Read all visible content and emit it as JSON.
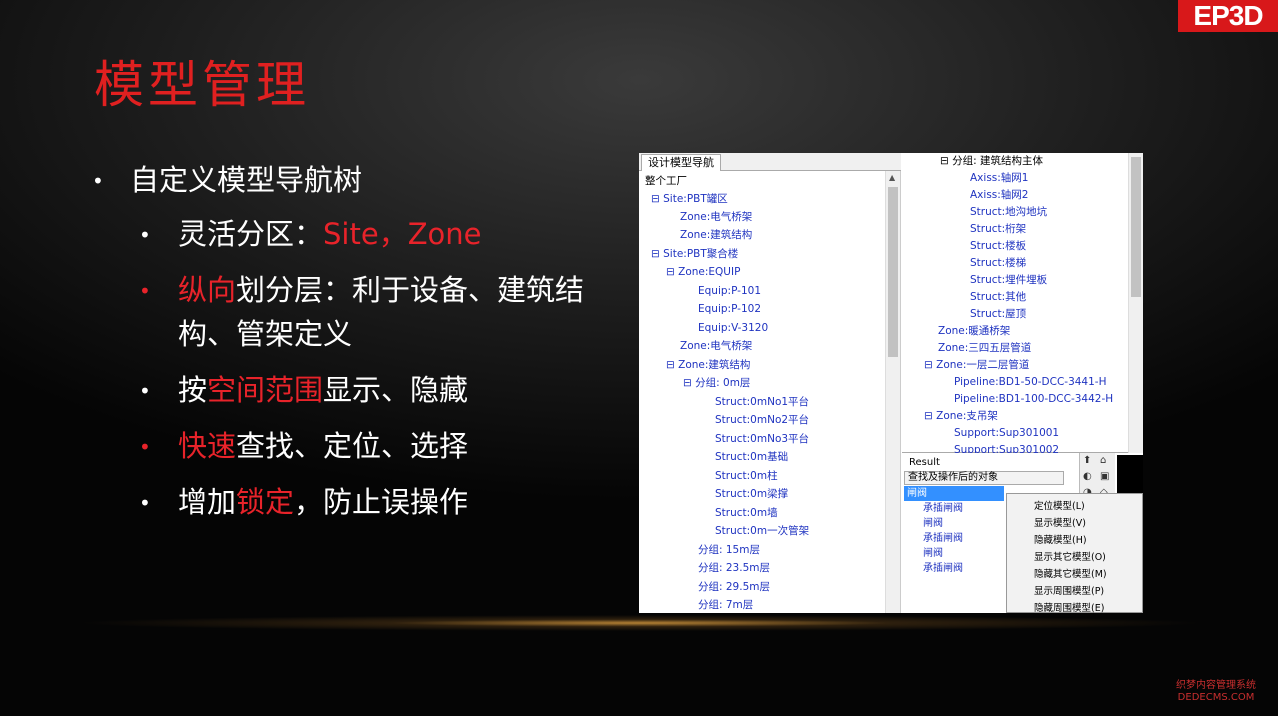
{
  "logo_text": "EP3D",
  "title": "模型管理",
  "bullets": {
    "main": "自定义模型导航树",
    "sub1_prefix": "灵活分区：",
    "sub1_red": "Site，Zone",
    "sub2_red": "纵向",
    "sub2_rest_line1": "划分层：利于设备、建筑结",
    "sub2_rest_line2": "构、管架定义",
    "sub3_prefix": "按",
    "sub3_red": "空间范围",
    "sub3_rest": "显示、隐藏",
    "sub4_red": "快速",
    "sub4_rest": "查找、定位、选择",
    "sub5_prefix": "增加",
    "sub5_red": "锁定",
    "sub5_rest": "，防止误操作"
  },
  "left_panel": {
    "tab": "设计模型导航",
    "tree": [
      "整个工厂",
      "⊟ Site:PBT罐区",
      "Zone:电气桥架",
      "Zone:建筑结构",
      "⊟ Site:PBT聚合楼",
      "⊟ Zone:EQUIP",
      "Equip:P-101",
      "Equip:P-102",
      "Equip:V-3120",
      "Zone:电气桥架",
      "⊟ Zone:建筑结构",
      "⊟ 分组: 0m层",
      "Struct:0mNo1平台",
      "Struct:0mNo2平台",
      "Struct:0mNo3平台",
      "Struct:0m基础",
      "Struct:0m柱",
      "Struct:0m梁撑",
      "Struct:0m墙",
      "Struct:0m一次管架",
      "分组: 15m层",
      "分组: 23.5m层",
      "分组: 29.5m层",
      "分组: 7m层"
    ]
  },
  "right_panel": {
    "tree": [
      "⊟ 分组: 建筑结构主体",
      "Axiss:轴网1",
      "Axiss:轴网2",
      "Struct:地沟地坑",
      "Struct:桁架",
      "Struct:楼板",
      "Struct:楼梯",
      "Struct:埋件埋板",
      "Struct:其他",
      "Struct:屋顶",
      "Zone:暖通桥架",
      "Zone:三四五层管道",
      "⊟ Zone:一层二层管道",
      "Pipeline:BD1-50-DCC-3441-H",
      "Pipeline:BD1-100-DCC-3442-H",
      "⊟ Zone:支吊架",
      "Support:Sup301001",
      "Support:Sup301002"
    ]
  },
  "result_panel": {
    "label": "Result",
    "header": "查找及操作后的对象",
    "items": [
      "闸阀",
      "承插闸阀",
      "闸阀",
      "承插闸阀",
      "闸阀",
      "承插闸阀"
    ]
  },
  "context_menu": [
    "定位模型(L)",
    "显示模型(V)",
    "隐藏模型(H)",
    "显示其它模型(O)",
    "隐藏其它模型(M)",
    "显示周围模型(P)",
    "隐藏周围模型(E)"
  ],
  "watermark": {
    "line1": "织梦内容管理系统",
    "line2": "DEDECMS.COM"
  }
}
